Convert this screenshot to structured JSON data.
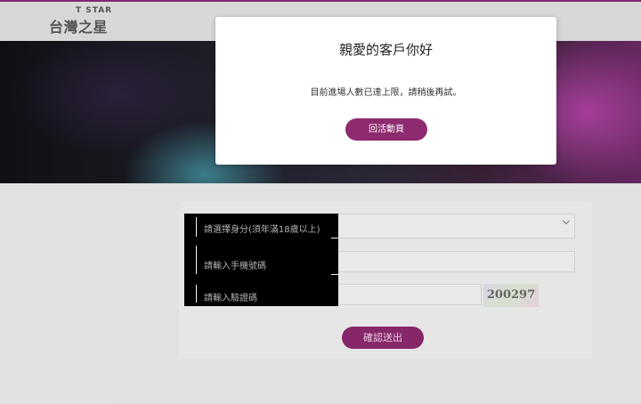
{
  "header": {
    "logo_en": "T STAR",
    "logo_zh": "台灣之星"
  },
  "form": {
    "field1_label": "請選擇身分(須年滿18歲以上)",
    "field2_label": "請輸入手機號碼",
    "field3_label": "請輸入驗證碼",
    "captcha_code": "200297",
    "submit_label": "確認送出"
  },
  "modal": {
    "title": "親愛的客戶你好",
    "message": "目前進場人數已達上限，請稍後再試。",
    "button_label": "回活動頁"
  },
  "colors": {
    "accent": "#8e2a6f",
    "topbar_border": "#8c2a72"
  }
}
